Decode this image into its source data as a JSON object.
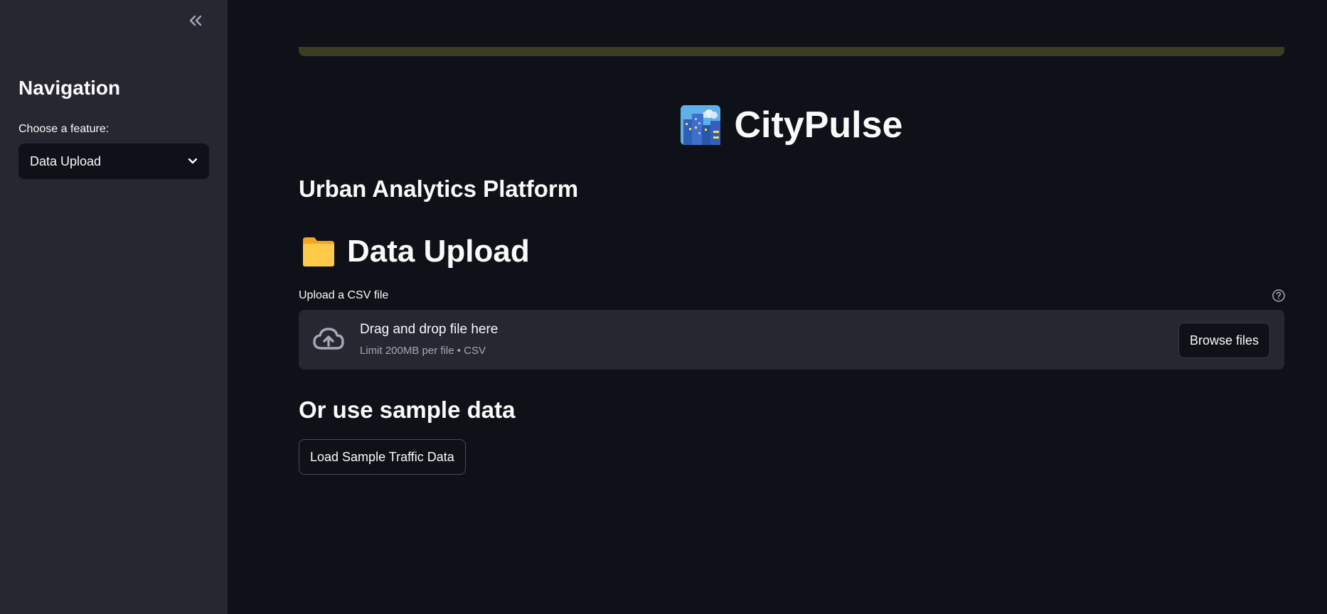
{
  "sidebar": {
    "collapse_icon": "double-chevron-left-icon",
    "title": "Navigation",
    "select_label": "Choose a feature:",
    "select_value": "Data Upload",
    "select_icon": "chevron-down-icon"
  },
  "main": {
    "app_icon": "cityscape-icon",
    "app_title": "CityPulse",
    "subtitle": "Urban Analytics Platform",
    "section_icon": "folder-icon",
    "section_title": "Data Upload",
    "uploader": {
      "label": "Upload a CSV file",
      "help_icon": "question-circle-icon",
      "upload_icon": "cloud-upload-icon",
      "title": "Drag and drop file here",
      "subtitle": "Limit 200MB per file • CSV",
      "browse_label": "Browse files"
    },
    "sample_title": "Or use sample data",
    "sample_button_label": "Load Sample Traffic Data"
  },
  "colors": {
    "background": "#0e1117",
    "sidebar": "#262730",
    "text": "#fafafa",
    "muted_text": "#a3a8b8",
    "banner": "#3d3d24"
  }
}
